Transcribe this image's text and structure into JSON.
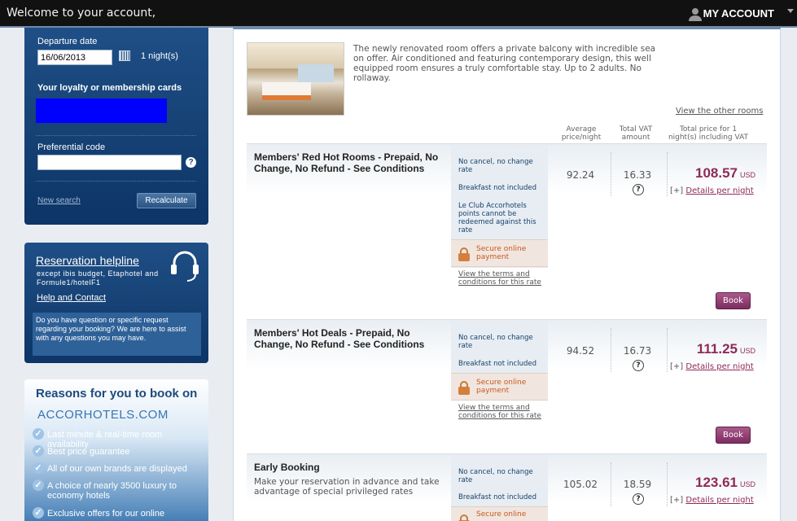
{
  "topbar": {
    "welcome": "Welcome to your account,",
    "account_label": "MY ACCOUNT"
  },
  "search": {
    "departure_label": "Departure date",
    "departure_value": "16/06/2013",
    "nights": "1 night(s)",
    "loyalty_label": "Your loyalty or membership cards",
    "preferential_label": "Preferential code",
    "preferential_value": "",
    "help_glyph": "?",
    "new_search": "New search",
    "recalculate": "Recalculate"
  },
  "helpline": {
    "title": "Reservation helpline",
    "subtitle": "except ibis budget, Etaphotel and Formule1/hotelF1",
    "help_contact": "Help and Contact",
    "question": "Do you have question or specific request regarding your booking? We are here to assist with any questions you may have."
  },
  "reasons": {
    "title": "Reasons for you to book on",
    "logo_text": "ACCORHOTELS.COM",
    "items": [
      "Last minute & real-time room availability",
      "Best price guarantee",
      "All of our own brands are displayed",
      "A choice of nearly 3500 luxury to economy hotels",
      "Exclusive offers for our online"
    ]
  },
  "room": {
    "description": "The newly renovated room offers a private balcony with incredible sea on offer. Air conditioned and featuring contemporary design, this well equipped room ensures a truly comfortable stay. Up to 2 adults. No rollaway.",
    "view_other": "View the other rooms"
  },
  "columns": {
    "avg": "Average price/night",
    "vat": "Total VAT amount",
    "total": "Total price for 1 night(s) including VAT"
  },
  "rates": [
    {
      "name": "Members' Red Hot Rooms - Prepaid, No Change, No Refund - See Conditions",
      "desc": "",
      "conds": [
        "No cancel, no change rate",
        "Breakfast not included",
        "Le Club Accorhotels points cannot be redeemed against this rate"
      ],
      "secure": "Secure online payment",
      "terms": "View the terms and conditions for this rate",
      "avg": "92.24",
      "vat": "16.33",
      "total": "108.57",
      "currency": "USD",
      "details_prefix": "[+]",
      "details": "Details per night",
      "book": "Book"
    },
    {
      "name": "Members' Hot Deals - Prepaid, No Change, No Refund - See Conditions",
      "desc": "",
      "conds": [
        "No cancel, no change rate",
        "Breakfast not included"
      ],
      "secure": "Secure online payment",
      "terms": "View the terms and conditions for this rate",
      "avg": "94.52",
      "vat": "16.73",
      "total": "111.25",
      "currency": "USD",
      "details_prefix": "[+]",
      "details": "Details per night",
      "book": "Book"
    },
    {
      "name": "Early Booking",
      "desc": "Make your reservation in advance and take advantage of special privileged rates",
      "conds": [
        "No cancel, no change rate",
        "Breakfast not included"
      ],
      "secure": "Secure online",
      "terms": "",
      "avg": "105.02",
      "vat": "18.59",
      "total": "123.61",
      "currency": "USD",
      "details_prefix": "[+]",
      "details": "Details per night",
      "book": ""
    }
  ],
  "qmark": "?"
}
